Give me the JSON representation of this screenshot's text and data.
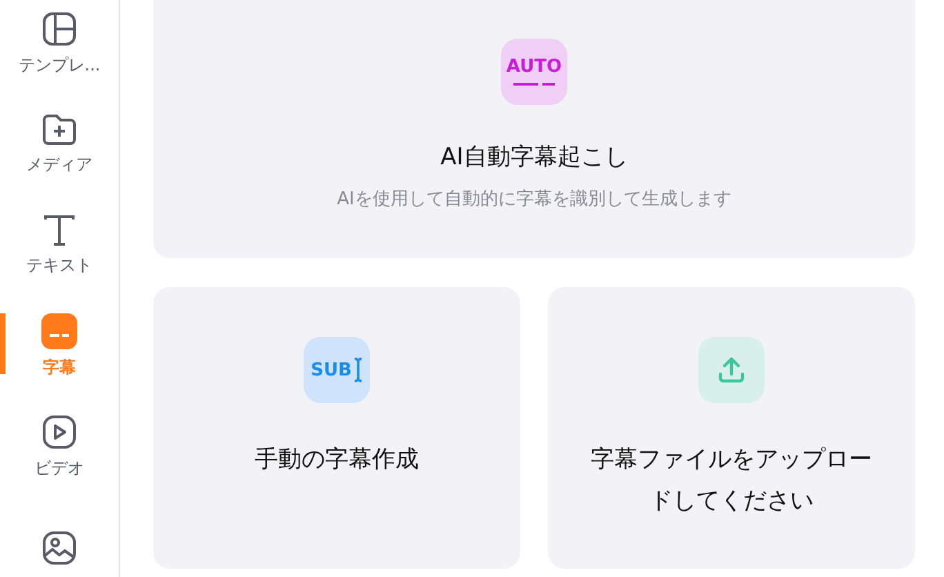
{
  "sidebar": {
    "items": [
      {
        "kind": "template",
        "label": "テンプレ...",
        "selected": false
      },
      {
        "kind": "media",
        "label": "メディア",
        "selected": false
      },
      {
        "kind": "text",
        "label": "テキスト",
        "selected": false
      },
      {
        "kind": "subtitle",
        "label": "字幕",
        "selected": true
      },
      {
        "kind": "video",
        "label": "ビデオ",
        "selected": false
      },
      {
        "kind": "image",
        "selected": false
      }
    ]
  },
  "feature_card": {
    "icon_text": "AUTO",
    "title": "AI自動字幕起こし",
    "description": "AIを使用して自動的に字幕を識別して生成します"
  },
  "option_cards": [
    {
      "kind": "manual",
      "icon_text": "SUB",
      "title": "手動の字幕作成"
    },
    {
      "kind": "upload",
      "title": "字幕ファイルをアップロードしてください"
    }
  ]
}
